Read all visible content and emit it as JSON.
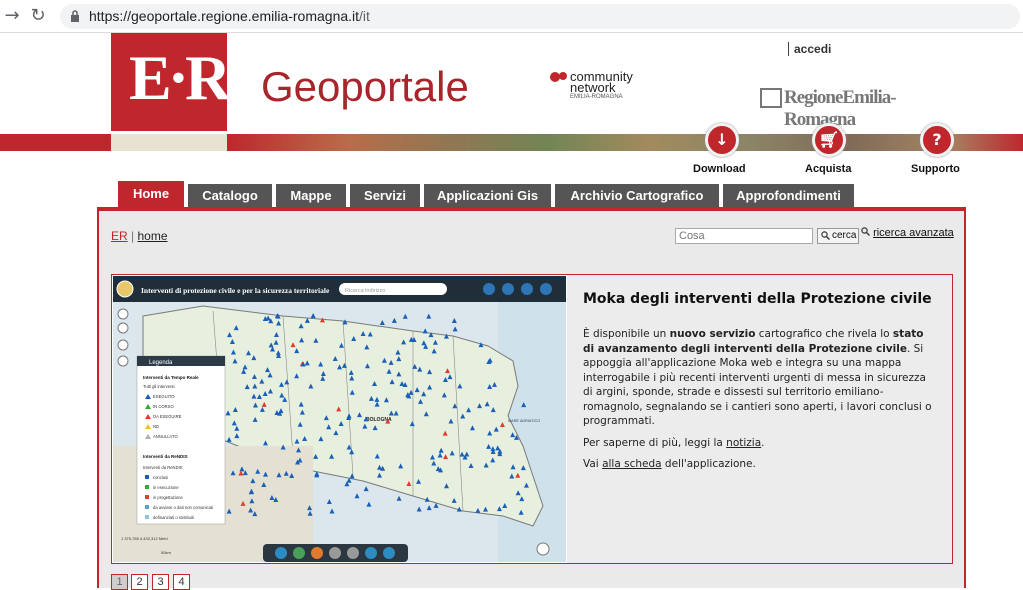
{
  "browser": {
    "url_main": "https://geoportale.regione.emilia-romagna.it",
    "url_path": "/it"
  },
  "header": {
    "logo_text": "E·R",
    "title": "Geoportale",
    "community_line1": "community",
    "community_line2": "network",
    "community_line3": "EMILIA-ROMAGNA",
    "rer_logo": "RegioneEmilia-Romagna",
    "login": "accedi",
    "actions": [
      {
        "label": "Download",
        "icon": "download-icon"
      },
      {
        "label": "Acquista",
        "icon": "cart-icon"
      },
      {
        "label": "Supporto",
        "icon": "help-icon"
      }
    ]
  },
  "nav": {
    "tabs": [
      "Home",
      "Catalogo",
      "Mappe",
      "Servizi",
      "Applicazioni Gis",
      "Archivio Cartografico",
      "Approfondimenti"
    ],
    "active": "Home"
  },
  "breadcrumb": {
    "root": "ER",
    "sep": "|",
    "current": "home"
  },
  "search": {
    "placeholder": "Cosa",
    "button": "cerca",
    "advanced": "ricerca avanzata"
  },
  "feature": {
    "map_title": "Interventi di protezione civile e per la sicurezza territoriale",
    "map_search_placeholder": "Ricerca indirizzo",
    "legend_title": "Legenda",
    "legend_section1": "Interventi da Tempo Reale",
    "legend_sub1": "Tutti gli interventi",
    "legend_items1": [
      "ESEGUITO",
      "IN CORSO",
      "DA ESEGUIRE",
      "ND",
      "ANNULLATO"
    ],
    "legend_section2": "Interventi da ReNDIS",
    "legend_sub2": "Interventi da ReNDIS",
    "legend_items2": [
      "conclusi",
      "in esecuzione",
      "in progettazione",
      "da avviare o dati non comunicati",
      "definanziati o sostituiti"
    ],
    "map_city": "BOLOGNA",
    "map_sea": "MARE ADRIATICO",
    "map_coords": "1 375,785 4.432,312 Metri",
    "map_scale": "50km",
    "heading": "Moka degli interventi della Protezione civile",
    "p1_a": "È disponibile un ",
    "p1_b": "nuovo servizio",
    "p1_c": " cartografico che rivela lo ",
    "p1_d": "stato di avanzamento degli interventi della Protezione civile",
    "p1_e": ". Si appoggia all'applicazione Moka web e integra su una mappa interrogabile i più recenti interventi urgenti di messa in sicurezza di argini, sponde, strade e dissesti sul territorio emiliano-romagnolo, segnalando se i cantieri sono aperti, i lavori conclusi o programmati.",
    "p2_a": "Per saperne di più, leggi la ",
    "p2_link": "notizia",
    "p2_b": ".",
    "p3_a": "Vai ",
    "p3_link": "alla scheda",
    "p3_b": " dell'applicazione."
  },
  "pager": [
    "1",
    "2",
    "3",
    "4"
  ],
  "colors": {
    "brand_red": "#c0272d",
    "tab_gray": "#555555"
  }
}
